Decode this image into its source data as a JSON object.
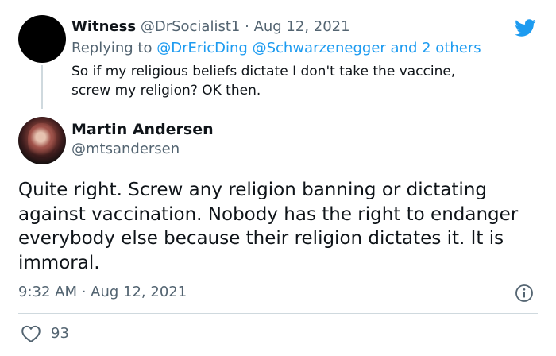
{
  "reply_tweet": {
    "display_name": "Witness",
    "handle": "@DrSocialist1",
    "separator": "·",
    "date": "Aug 12, 2021",
    "replying_prefix": "Replying to",
    "replying_users": [
      "@DrEricDing",
      "@Schwarzenegger"
    ],
    "replying_suffix": "and 2 others",
    "text_line1": "So if my religious beliefs dictate I don't take the vaccine,",
    "text_line2": "screw my religion? OK then."
  },
  "main_tweet": {
    "display_name": "Martin Andersen",
    "handle": "@mtsandersen",
    "text": "Quite right. Screw any religion banning or dictating against vaccination. Nobody has the right to endanger everybody else because their religion dictates it. It is immoral.",
    "timestamp": "9:32 AM · Aug 12, 2021",
    "likes": "93"
  },
  "icons": {
    "brand": "twitter-bird-icon",
    "info": "info-icon",
    "like": "heart-icon"
  },
  "colors": {
    "twitter_blue": "#1d9bf0",
    "secondary_text": "#536471",
    "primary_text": "#0f1419",
    "divider": "#cfd9de"
  }
}
